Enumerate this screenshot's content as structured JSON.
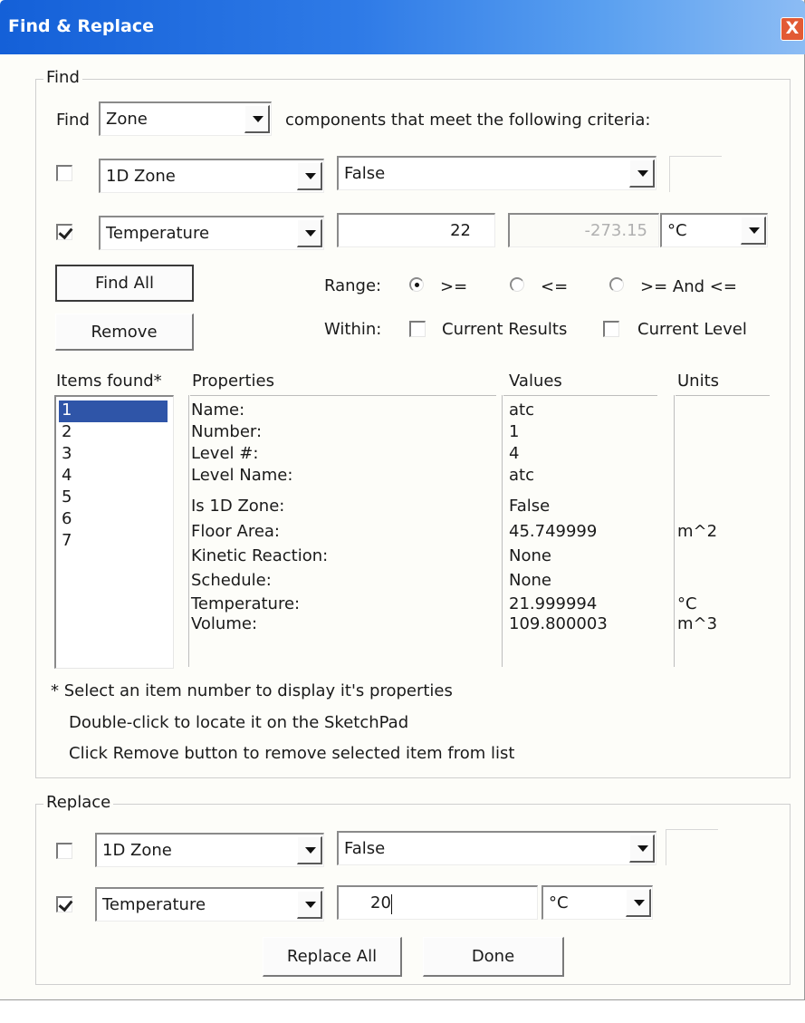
{
  "window": {
    "title": "Find & Replace",
    "close_glyph": "X"
  },
  "find": {
    "legend": "Find",
    "find_label": "Find",
    "component_type": "Zone",
    "criteria_text": "components that meet the following criteria:",
    "criteria": [
      {
        "checked": false,
        "property": "1D Zone",
        "value": "False",
        "extra": ""
      },
      {
        "checked": true,
        "property": "Temperature",
        "value": "22",
        "value2": "-273.15",
        "unit": "°C"
      }
    ],
    "find_all_label": "Find All",
    "remove_label": "Remove",
    "range_label": "Range:",
    "range_options": [
      {
        "label": ">=",
        "selected": true
      },
      {
        "label": "<=",
        "selected": false
      },
      {
        "label": ">= And <=",
        "selected": false
      }
    ],
    "within_label": "Within:",
    "within_options": [
      {
        "label": "Current Results",
        "checked": false
      },
      {
        "label": "Current Level",
        "checked": false
      }
    ],
    "items_found_label": "Items found*",
    "items": [
      "1",
      "2",
      "3",
      "4",
      "5",
      "6",
      "7"
    ],
    "selected_item": "1",
    "columns": {
      "properties": "Properties",
      "values": "Values",
      "units": "Units"
    },
    "properties": [
      {
        "name": "Name:",
        "value": "atc",
        "unit": ""
      },
      {
        "name": "Number:",
        "value": "1",
        "unit": ""
      },
      {
        "name": "Level #:",
        "value": "4",
        "unit": ""
      },
      {
        "name": "Level Name:",
        "value": "atc",
        "unit": ""
      },
      {
        "name": "Is 1D Zone:",
        "value": "False",
        "unit": ""
      },
      {
        "name": "Floor Area:",
        "value": "45.749999",
        "unit": "m^2"
      },
      {
        "name": "Kinetic Reaction:",
        "value": "None",
        "unit": ""
      },
      {
        "name": "Schedule:",
        "value": "None",
        "unit": ""
      },
      {
        "name": "Temperature:",
        "value": "21.999994",
        "unit": "°C"
      },
      {
        "name": "Volume:",
        "value": "109.800003",
        "unit": "m^3"
      }
    ],
    "notes": [
      "* Select an item number to display it's properties",
      "Double-click to locate it on the SketchPad",
      "Click Remove button to remove selected item from list"
    ]
  },
  "replace": {
    "legend": "Replace",
    "criteria": [
      {
        "checked": false,
        "property": "1D Zone",
        "value": "False"
      },
      {
        "checked": true,
        "property": "Temperature",
        "value": "20",
        "unit": "°C"
      }
    ],
    "replace_all_label": "Replace All",
    "done_label": "Done"
  }
}
